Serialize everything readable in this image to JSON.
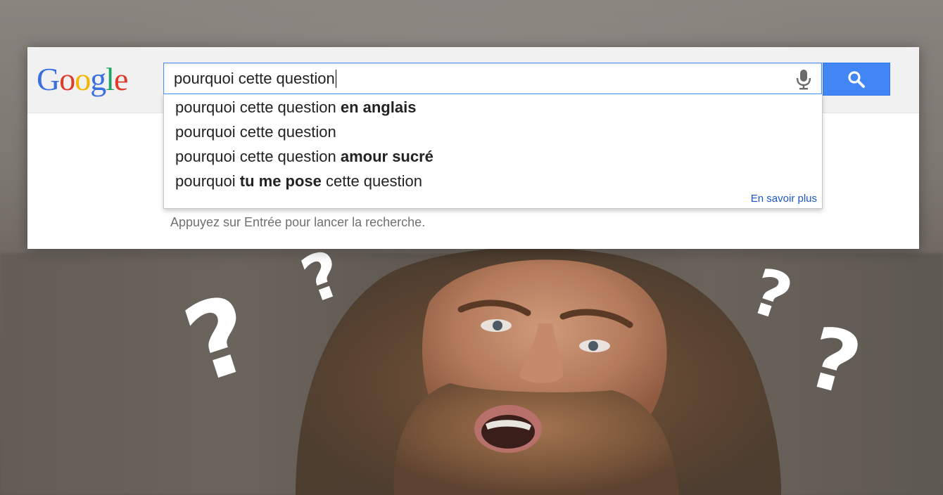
{
  "logo": {
    "letters": [
      "G",
      "o",
      "o",
      "g",
      "l",
      "e"
    ],
    "colors": [
      "#3b6fe0",
      "#dd3b2c",
      "#f4b400",
      "#3b6fe0",
      "#1ea362",
      "#dd3b2c"
    ]
  },
  "search": {
    "query": "pourquoi cette question",
    "mic_icon": "microphone-icon",
    "button_icon": "search-icon",
    "button_color": "#4285f4"
  },
  "suggestions": [
    {
      "prefix": "pourquoi cette question ",
      "bold": "en anglais",
      "suffix": ""
    },
    {
      "prefix": "pourquoi cette question",
      "bold": "",
      "suffix": ""
    },
    {
      "prefix": "pourquoi cette question ",
      "bold": "amour sucré",
      "suffix": ""
    },
    {
      "prefix": "pourquoi ",
      "bold": "tu me pose",
      "suffix": " cette question"
    }
  ],
  "learn_more": "En savoir plus",
  "hint": "Appuyez sur Entrée pour lancer la recherche.",
  "question_marks": [
    "?",
    "?",
    "?",
    "?"
  ]
}
